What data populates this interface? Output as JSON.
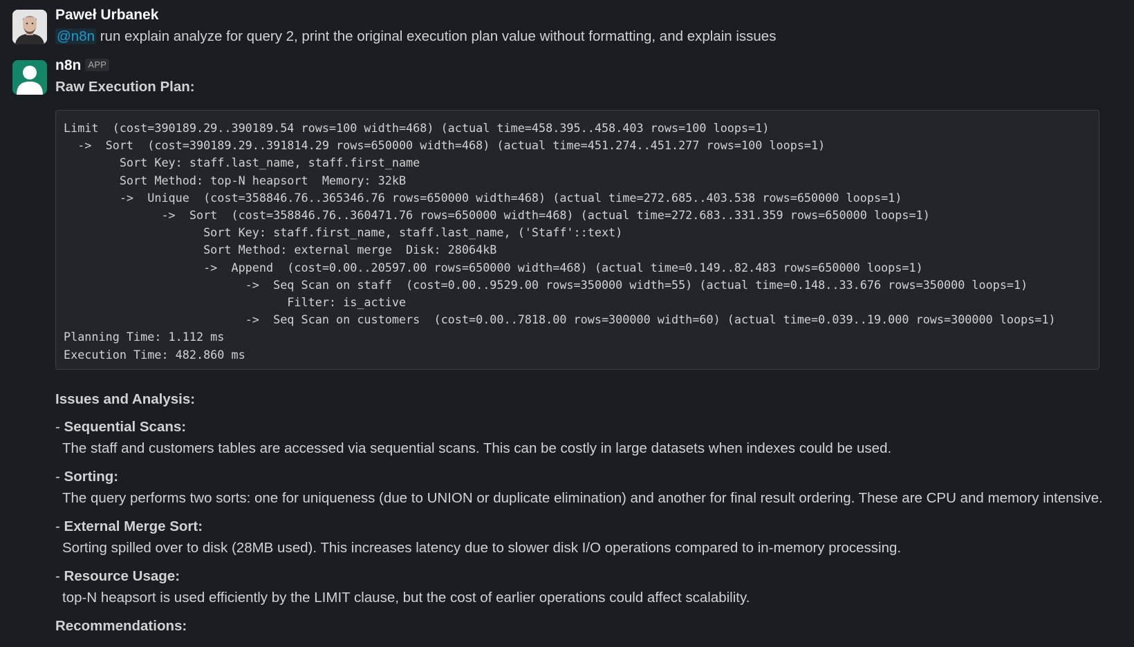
{
  "messages": [
    {
      "author": "Paweł Urbanek",
      "mention": "@n8n",
      "text": " run explain analyze for query 2, print the original execution plan value without formatting, and explain issues"
    },
    {
      "author": "n8n",
      "badge": "APP",
      "heading": "Raw Execution Plan:",
      "code": "Limit  (cost=390189.29..390189.54 rows=100 width=468) (actual time=458.395..458.403 rows=100 loops=1)\n  ->  Sort  (cost=390189.29..391814.29 rows=650000 width=468) (actual time=451.274..451.277 rows=100 loops=1)\n        Sort Key: staff.last_name, staff.first_name\n        Sort Method: top-N heapsort  Memory: 32kB\n        ->  Unique  (cost=358846.76..365346.76 rows=650000 width=468) (actual time=272.685..403.538 rows=650000 loops=1)\n              ->  Sort  (cost=358846.76..360471.76 rows=650000 width=468) (actual time=272.683..331.359 rows=650000 loops=1)\n                    Sort Key: staff.first_name, staff.last_name, ('Staff'::text)\n                    Sort Method: external merge  Disk: 28064kB\n                    ->  Append  (cost=0.00..20597.00 rows=650000 width=468) (actual time=0.149..82.483 rows=650000 loops=1)\n                          ->  Seq Scan on staff  (cost=0.00..9529.00 rows=350000 width=55) (actual time=0.148..33.676 rows=350000 loops=1)\n                                Filter: is_active\n                          ->  Seq Scan on customers  (cost=0.00..7818.00 rows=300000 width=60) (actual time=0.039..19.000 rows=300000 loops=1)\nPlanning Time: 1.112 ms\nExecution Time: 482.860 ms",
      "issues_heading": "Issues and Analysis:",
      "issues": [
        {
          "prefix": "- ",
          "title": "Sequential Scans:",
          "desc": "The staff and customers tables are accessed via sequential scans. This can be costly in large datasets when indexes could be used."
        },
        {
          "prefix": "- ",
          "title": "Sorting:",
          "desc": "The query performs two sorts: one for uniqueness (due to UNION or duplicate elimination) and another for final result ordering. These are CPU and memory intensive."
        },
        {
          "prefix": "- ",
          "title": "External Merge Sort:",
          "desc": "Sorting spilled over to disk (28MB used). This increases latency due to slower disk I/O operations compared to in-memory processing."
        },
        {
          "prefix": "- ",
          "title": "Resource Usage:",
          "desc": "top-N heapsort is used efficiently by the LIMIT clause, but the cost of earlier operations could affect scalability."
        }
      ],
      "recommendations_heading": "Recommendations:"
    }
  ],
  "colors": {
    "background": "#1a1d21",
    "code_background": "#222529",
    "mention": "#1d9bd1",
    "bot_avatar": "#148567"
  },
  "icons": [
    "user-photo-avatar",
    "bot-person-avatar"
  ]
}
